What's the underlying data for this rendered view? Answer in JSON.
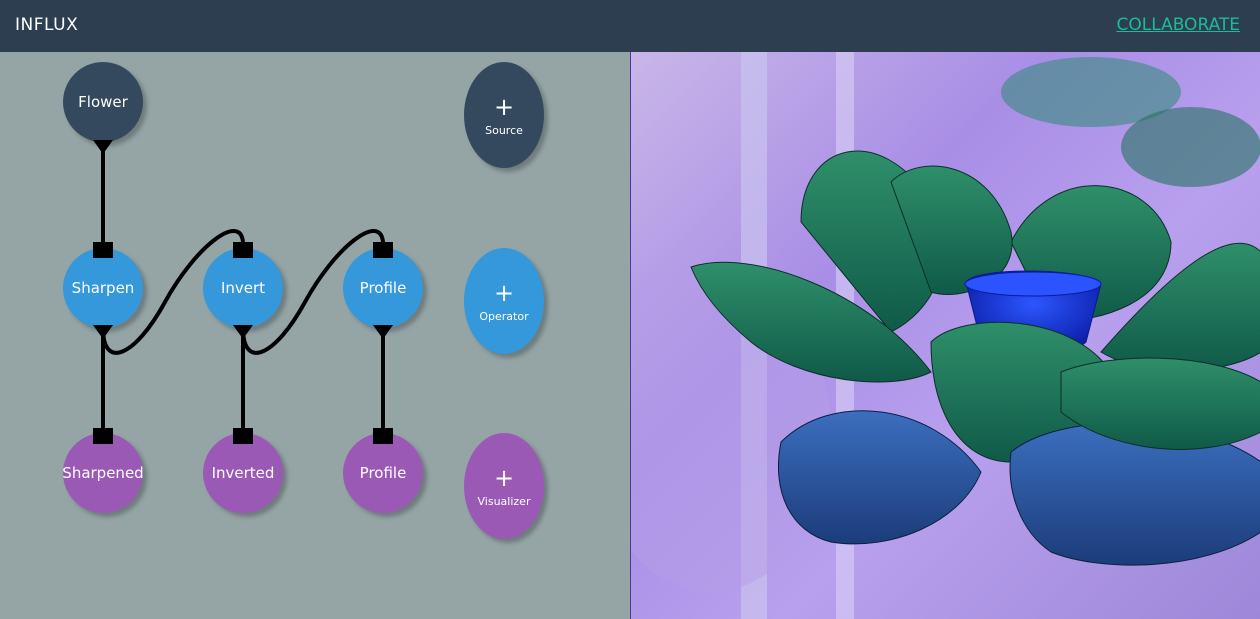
{
  "header": {
    "title": "INFLUX",
    "collaborate_label": "COLLABORATE"
  },
  "nodes": {
    "flower": "Flower",
    "sharpen": "Sharpen",
    "invert": "Invert",
    "profile_op": "Profile",
    "sharpened": "Sharpened",
    "inverted": "Inverted",
    "profile_vis": "Profile"
  },
  "add_buttons": {
    "plus": "+",
    "source": "Source",
    "operator": "Operator",
    "visualizer": "Visualizer"
  },
  "colors": {
    "header_bg": "#2c3e50",
    "canvas_bg": "#95a5a6",
    "source": "#34495e",
    "operator": "#3498db",
    "visualizer": "#9b59b6",
    "link": "#1abc9c"
  },
  "viewer": {
    "icon": "lotus-flower-image"
  }
}
